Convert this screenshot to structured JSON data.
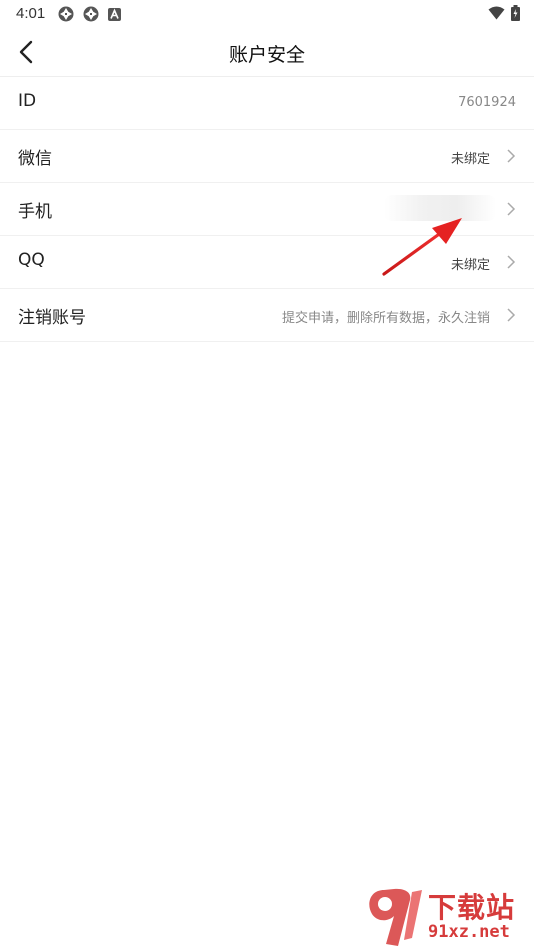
{
  "status_bar": {
    "time": "4:01",
    "icons_left": [
      "aperture-icon",
      "aperture-icon",
      "a-badge-icon"
    ],
    "icons_right": [
      "wifi-icon",
      "battery-icon"
    ]
  },
  "header": {
    "title": "账户安全",
    "back_icon": "back-chevron-icon"
  },
  "rows": [
    {
      "label": "ID",
      "value": "7601924",
      "chevron": false
    },
    {
      "label": "微信",
      "value": "未绑定",
      "chevron": true
    },
    {
      "label": "手机",
      "value": "",
      "chevron": true,
      "value_obscured": true
    },
    {
      "label": "QQ",
      "value": "未绑定",
      "chevron": true
    },
    {
      "label": "注销账号",
      "value": "提交申请，删除所有数据，永久注销",
      "chevron": true
    }
  ],
  "watermark": {
    "text": "下载站",
    "domain": "91xz.net"
  },
  "colors": {
    "background": "#ffffff",
    "divider": "#f0f0f0",
    "annotation_arrow": "#e02020",
    "watermark": "#d63b3b"
  }
}
